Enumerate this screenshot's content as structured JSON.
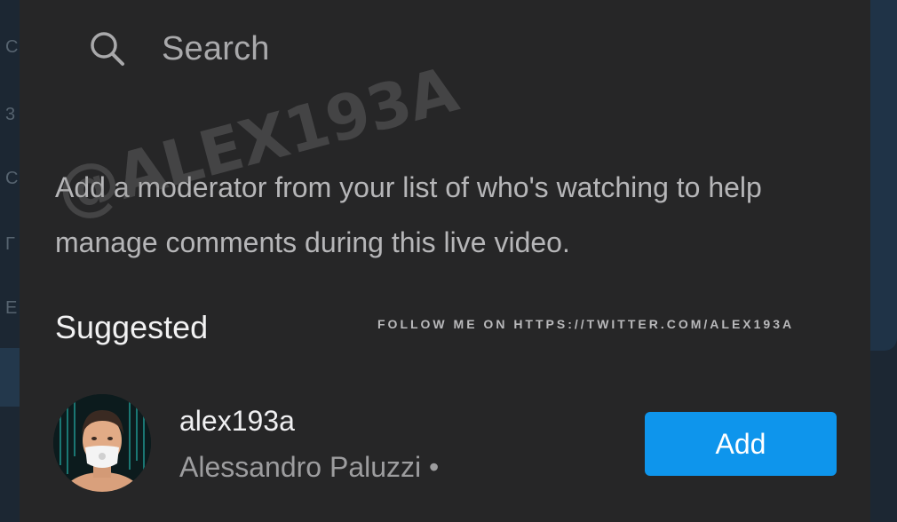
{
  "search": {
    "label": "Search",
    "icon": "search-icon"
  },
  "description": "Add a moderator from your list of who's watching to help manage comments during this live video.",
  "watermark": "@ALEX193A",
  "suggested": {
    "title": "Suggested",
    "follow_note": "FOLLOW ME ON HTTPS://TWITTER.COM/ALEX193A"
  },
  "user": {
    "username": "alex193a",
    "full_name": "Alessandro Paluzzi •",
    "add_label": "Add"
  },
  "colors": {
    "sheet_background": "#262627",
    "add_button": "#0e95ec",
    "primary_text": "#f0f0f2",
    "secondary_text": "#9d9d9f"
  }
}
